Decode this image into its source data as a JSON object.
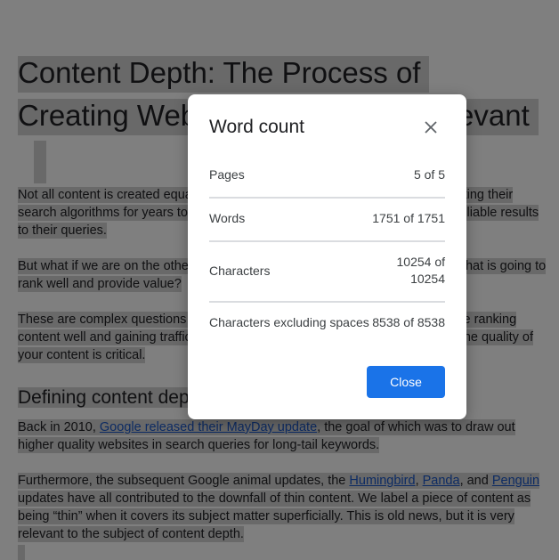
{
  "document": {
    "title_line1": "Content Depth: The Process of",
    "title_line2": "Creating Web Content That Is Relevant",
    "para1": "Not all content is created equal. Search engines like Google have been perfecting their search algorithms for years to provide their users with the most relevant and reliable results to their queries.",
    "para2": "But what if we are on the other side of the search? How do we create content that is going to rank well and provide value?",
    "para3": "These are complex questions that do not have a simple or single answer. While ranking content well and gaining traffic depends on a combination of different factors, the quality of your content is critical.",
    "heading2": "Defining content depth",
    "para4_pre": "Back in 2010, ",
    "para4_link": "Google released their MayDay update",
    "para4_post": ", the goal of which was to draw out higher quality websites in search queries for long-tail keywords.",
    "para5_a": "Furthermore, the subsequent Google animal updates, the ",
    "para5_link1": "Humingbird",
    "para5_b": ", ",
    "para5_link2": "Panda",
    "para5_c": ", and ",
    "para5_link3": "Penguin",
    "para5_d": " updates have all contributed to the downfall of thin content. We label a piece of content as being “thin” when it covers its subject matter superficially. This is old news, but it is very relevant to the subject of content depth."
  },
  "dialog": {
    "title": "Word count",
    "close_icon": "close-icon",
    "rows": [
      {
        "label": "Pages",
        "value": "5 of 5"
      },
      {
        "label": "Words",
        "value": "1751 of 1751"
      },
      {
        "label": "Characters",
        "value_line1": "10254 of",
        "value_line2": "10254"
      },
      {
        "label": "Characters excluding spaces",
        "value": "8538 of 8538"
      }
    ],
    "close_button": "Close"
  },
  "colors": {
    "accent": "#1a73e8",
    "selection": "#d2d2d2",
    "link": "#1a56c6",
    "overlay": "rgba(0,0,0,0.5)"
  }
}
